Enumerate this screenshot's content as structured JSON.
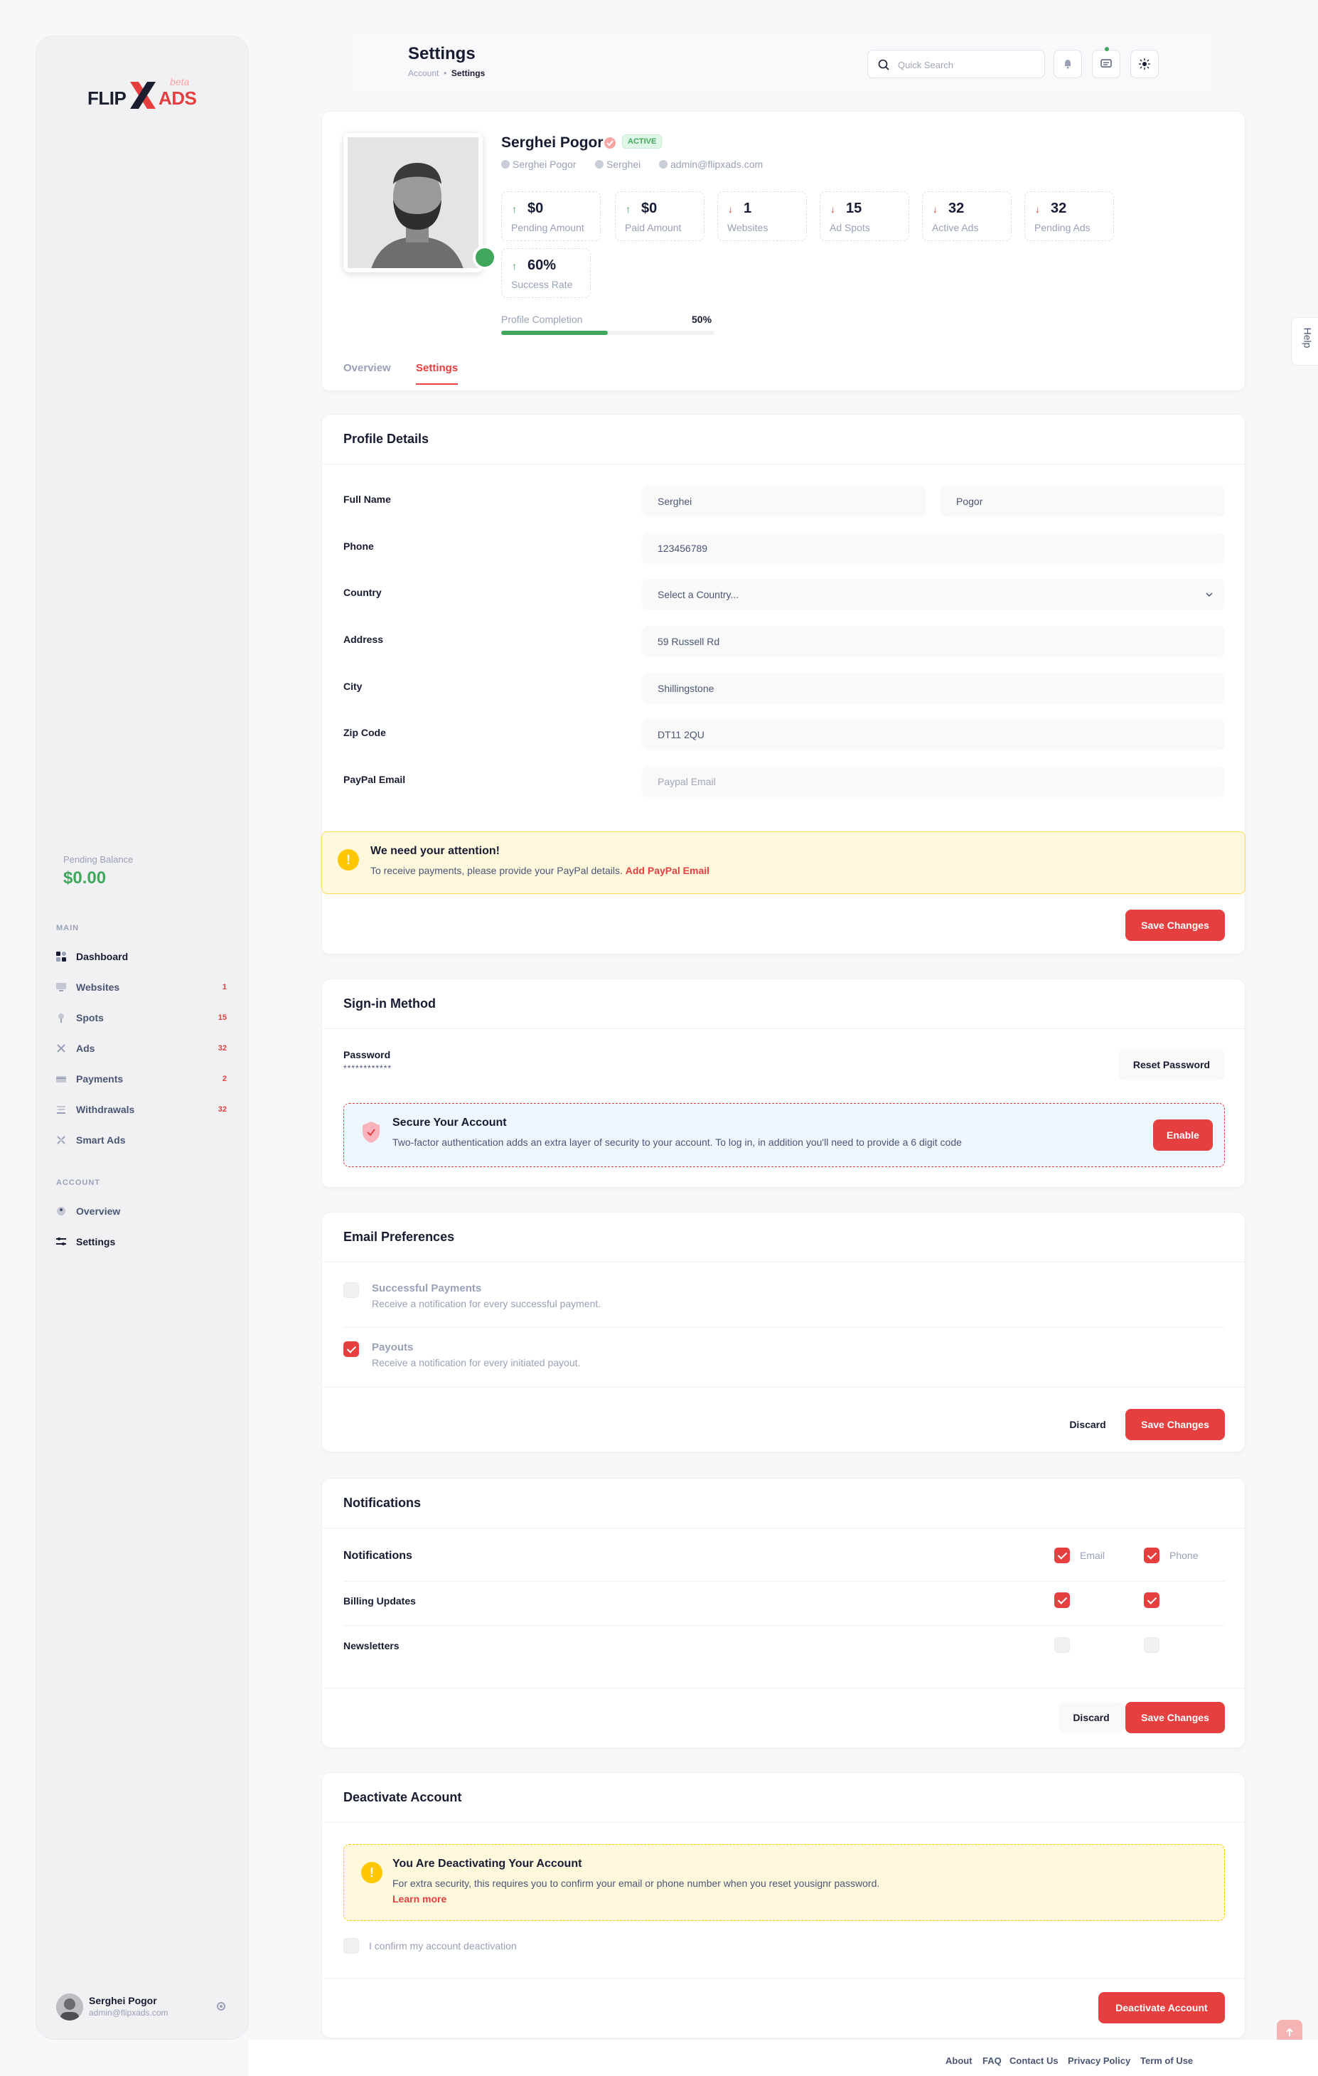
{
  "sidebar": {
    "logo": {
      "flip": "FLIP",
      "ads": "ADS",
      "beta": "beta"
    },
    "pending_balance_label": "Pending Balance",
    "pending_balance_value": "$0.00",
    "main_heading": "MAIN",
    "main_items": [
      {
        "label": "Dashboard",
        "badge": "",
        "icon": "dashboard-icon"
      },
      {
        "label": "Websites",
        "badge": "1",
        "icon": "websites-icon"
      },
      {
        "label": "Spots",
        "badge": "15",
        "icon": "spots-icon"
      },
      {
        "label": "Ads",
        "badge": "32",
        "icon": "ads-icon"
      },
      {
        "label": "Payments",
        "badge": "2",
        "icon": "payments-icon"
      },
      {
        "label": "Withdrawals",
        "badge": "32",
        "icon": "withdrawals-icon"
      },
      {
        "label": "Smart Ads",
        "badge": "",
        "icon": "smart-ads-icon"
      }
    ],
    "account_heading": "ACCOUNT",
    "account_items": [
      {
        "label": "Overview",
        "icon": "overview-icon"
      },
      {
        "label": "Settings",
        "icon": "settings-icon"
      }
    ],
    "user": {
      "name": "Serghei Pogor",
      "email": "admin@flipxads.com"
    }
  },
  "header": {
    "title": "Settings",
    "crumb_parent": "Account",
    "crumb_current": "Settings",
    "search_placeholder": "Quick Search"
  },
  "profile": {
    "name": "Serghei Pogor",
    "status": "ACTIVE",
    "meta": [
      "Serghei Pogor",
      "Serghei",
      "admin@flipxads.com"
    ],
    "stats": [
      {
        "value": "$0",
        "label": "Pending Amount",
        "trend": "up"
      },
      {
        "value": "$0",
        "label": "Paid Amount",
        "trend": "up"
      },
      {
        "value": "1",
        "label": "Websites",
        "trend": "down"
      },
      {
        "value": "15",
        "label": "Ad Spots",
        "trend": "down"
      },
      {
        "value": "32",
        "label": "Active Ads",
        "trend": "down"
      },
      {
        "value": "32",
        "label": "Pending Ads",
        "trend": "down"
      },
      {
        "value": "60%",
        "label": "Success Rate",
        "trend": "up"
      }
    ],
    "completion_label": "Profile Completion",
    "completion_value": "50%",
    "completion_fraction": 0.5,
    "tabs": [
      "Overview",
      "Settings"
    ],
    "active_tab": "Settings"
  },
  "profile_details": {
    "title": "Profile Details",
    "labels": {
      "full_name": "Full Name",
      "phone": "Phone",
      "country": "Country",
      "address": "Address",
      "city": "City",
      "zip": "Zip Code",
      "paypal": "PayPal Email"
    },
    "values": {
      "first_name": "Serghei",
      "last_name": "Pogor",
      "phone": "123456789",
      "country": "Select a Country...",
      "address": "59 Russell Rd",
      "city": "Shillingstone",
      "zip": "DT11 2QU"
    },
    "paypal_placeholder": "Paypal Email",
    "notice_title": "We need your attention!",
    "notice_text": "To receive payments, please provide your PayPal details.",
    "notice_link": "Add PayPal Email",
    "save_label": "Save Changes"
  },
  "signin": {
    "title": "Sign-in Method",
    "password_label": "Password",
    "password_mask": "************",
    "reset_label": "Reset Password",
    "secure_title": "Secure Your Account",
    "secure_text": "Two-factor authentication adds an extra layer of security to your account. To log in, in addition you'll need to provide a 6 digit code",
    "enable_label": "Enable"
  },
  "email_prefs": {
    "title": "Email Preferences",
    "items": [
      {
        "title": "Successful Payments",
        "desc": "Receive a notification for every successful payment.",
        "checked": false
      },
      {
        "title": "Payouts",
        "desc": "Receive a notification for every initiated payout.",
        "checked": true
      }
    ],
    "discard_label": "Discard",
    "save_label": "Save Changes"
  },
  "notifications": {
    "title": "Notifications",
    "header_label": "Notifications",
    "col_email": "Email",
    "col_phone": "Phone",
    "rows": [
      {
        "label": "Billing Updates",
        "email": true,
        "phone": true
      },
      {
        "label": "Newsletters",
        "email": false,
        "phone": false
      }
    ],
    "discard_label": "Discard",
    "save_label": "Save Changes"
  },
  "deactivate": {
    "title": "Deactivate Account",
    "warn_title": "You Are Deactivating Your Account",
    "warn_text": "For extra security, this requires you to confirm your email or phone number when you reset yousignr password.",
    "learn_more": "Learn more",
    "confirm_label": "I confirm my account deactivation",
    "button_label": "Deactivate Account"
  },
  "footer": {
    "links": [
      "About",
      "FAQ",
      "Contact Us",
      "Privacy Policy",
      "Term of Use"
    ]
  },
  "help_label": "Help",
  "colors": {
    "accent": "#e5403f",
    "success": "#41a75c",
    "warning": "#ffc700"
  }
}
